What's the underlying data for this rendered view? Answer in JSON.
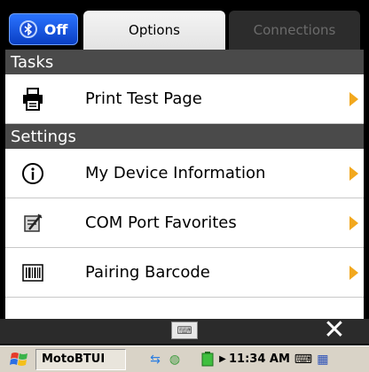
{
  "topbar": {
    "bluetooth_toggle_label": "Off",
    "tabs": [
      {
        "label": "Options",
        "active": true
      },
      {
        "label": "Connections",
        "active": false
      }
    ]
  },
  "sections": {
    "tasks": {
      "title": "Tasks",
      "items": [
        {
          "label": "Print Test Page",
          "icon": "printer-icon"
        }
      ]
    },
    "settings": {
      "title": "Settings",
      "items": [
        {
          "label": "My Device Information",
          "icon": "info-icon"
        },
        {
          "label": "COM Port Favorites",
          "icon": "com-port-icon"
        },
        {
          "label": "Pairing Barcode",
          "icon": "barcode-icon"
        }
      ]
    }
  },
  "toolbar": {
    "keyboard_icon": "keyboard-icon",
    "close_icon": "close-icon"
  },
  "taskbar": {
    "start_icon": "windows-flag-icon",
    "active_app": "MotoBTUI",
    "clock": "11:34 AM"
  },
  "colors": {
    "accent_arrow": "#f2a81e",
    "section_header": "#4a4a4a",
    "bluetooth_button": "#1e5ee8"
  }
}
